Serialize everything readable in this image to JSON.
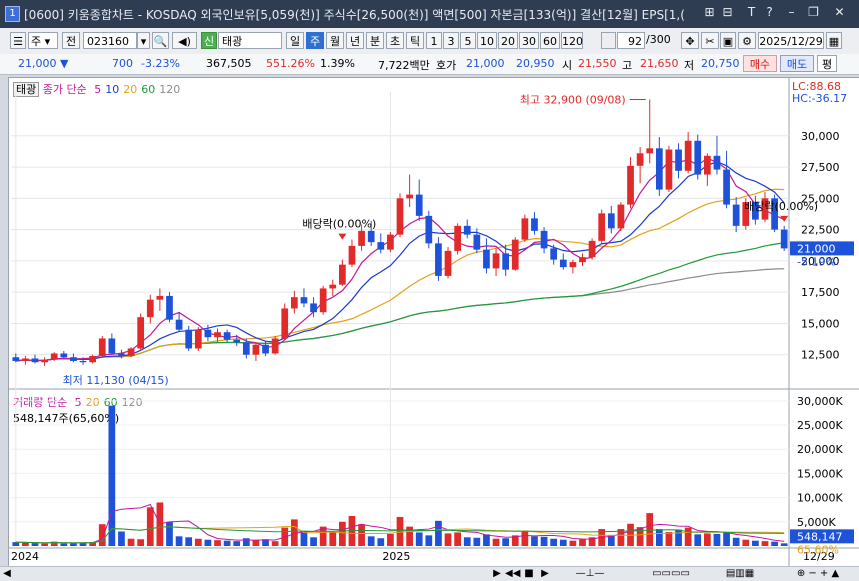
{
  "window": {
    "badge": "1",
    "title": "[0600] 키움종합차트 - KOSDAQ 외국인보유[5,059(천)] 주식수[26,500(천)] 액면[500] 자본금[133(억)] 결산[12월] EPS[1,(",
    "buttons": [
      "⊞",
      "⊟",
      "T",
      "?",
      "–",
      "❐",
      "✕"
    ]
  },
  "toolbar": {
    "type": "주",
    "period_sel": "전",
    "code": "023160",
    "name_badge": "신",
    "name": "태광",
    "periods": [
      "일",
      "주",
      "월",
      "년",
      "분",
      "초",
      "틱"
    ],
    "selected_period": "주",
    "intervals": [
      "1",
      "3",
      "5",
      "10",
      "20",
      "30",
      "60",
      "120"
    ],
    "count": "92",
    "count_total": "/300",
    "date": "2025/12/29"
  },
  "quote": {
    "price": "21,000",
    "change_arrow": "▼",
    "change": "700",
    "change_pct": "-3.23%",
    "volume": "367,505",
    "volume_ratio": "551.26%",
    "turnover": "1.39%",
    "amount": "7,722백만",
    "hoga_label": "호가",
    "ask": "21,000",
    "bid": "20,950",
    "open_label": "시",
    "open": "21,550",
    "high_label": "고",
    "high": "21,650",
    "low_label": "저",
    "low": "20,750",
    "buy": "매수",
    "sell": "매도",
    "avg": "평"
  },
  "legend_price": {
    "name": "태광",
    "ma_label": "종가 단순",
    "ma": [
      {
        "label": "5",
        "color": "#c2189b"
      },
      {
        "label": "10",
        "color": "#1a3bd0"
      },
      {
        "label": "20",
        "color": "#e3a21a"
      },
      {
        "label": "60",
        "color": "#1f9a3c"
      },
      {
        "label": "120",
        "color": "#8c8c8c"
      }
    ]
  },
  "legend_volume": {
    "label": "거래량 단순",
    "ma": [
      {
        "label": "5",
        "color": "#c2189b"
      },
      {
        "label": "20",
        "color": "#e3a21a"
      },
      {
        "label": "60",
        "color": "#1f9a3c"
      },
      {
        "label": "120",
        "color": "#8c8c8c"
      }
    ],
    "current": "548,147주(65,60%)"
  },
  "annotations": {
    "max": "최고 32,900 (09/08)",
    "min": "최저 11,130 (04/15)",
    "exdiv": "배당락(0.00%)",
    "lc": "LC:88.68",
    "hc": "HC:-36.17",
    "last_price": "21,000",
    "last_pct": "-5.19%",
    "vol_last": "548,147",
    "vol_pct": "65.60%",
    "date_end": "12/29"
  },
  "chart_data": [
    {
      "type": "candlestick",
      "yticks": [
        "12,500",
        "15,000",
        "17,500",
        "20,000",
        "22,500",
        "25,000",
        "27,500",
        "30,000"
      ],
      "ylim": [
        10000,
        33500
      ],
      "xticks": [
        "2024",
        "2025"
      ],
      "series": [
        {
          "name": "태광",
          "values": [
            [
              12300,
              12600,
              11900,
              12000
            ],
            [
              12000,
              12400,
              11700,
              12200
            ],
            [
              12200,
              12500,
              11800,
              11900
            ],
            [
              11900,
              12300,
              11600,
              12100
            ],
            [
              12100,
              12700,
              12000,
              12600
            ],
            [
              12600,
              12800,
              12200,
              12300
            ],
            [
              12300,
              12600,
              11900,
              12000
            ],
            [
              12000,
              12300,
              11700,
              11900
            ],
            [
              11900,
              12500,
              11800,
              12400
            ],
            [
              12400,
              14000,
              12300,
              13800
            ],
            [
              13800,
              14200,
              12500,
              12600
            ],
            [
              12600,
              12900,
              12200,
              12400
            ],
            [
              12400,
              13100,
              12300,
              13000
            ],
            [
              13000,
              15800,
              12900,
              15500
            ],
            [
              15500,
              17300,
              15000,
              16900
            ],
            [
              16900,
              17800,
              16000,
              17200
            ],
            [
              17200,
              17500,
              15100,
              15300
            ],
            [
              15300,
              15900,
              14400,
              14500
            ],
            [
              14500,
              14800,
              12800,
              13000
            ],
            [
              13000,
              14700,
              12800,
              14500
            ],
            [
              14500,
              14900,
              13600,
              13900
            ],
            [
              13900,
              14600,
              13500,
              14300
            ],
            [
              14300,
              14500,
              13500,
              13700
            ],
            [
              13700,
              14100,
              13200,
              13500
            ],
            [
              13500,
              13800,
              12200,
              12500
            ],
            [
              12500,
              13500,
              12000,
              13300
            ],
            [
              13300,
              13600,
              12400,
              12600
            ],
            [
              12600,
              14000,
              12500,
              13800
            ],
            [
              13800,
              16600,
              13700,
              16200
            ],
            [
              16200,
              17600,
              15800,
              17100
            ],
            [
              17100,
              17800,
              16300,
              16600
            ],
            [
              16600,
              17100,
              15500,
              15900
            ],
            [
              15900,
              18000,
              15700,
              17800
            ],
            [
              17800,
              18500,
              17200,
              18100
            ],
            [
              18100,
              20100,
              18000,
              19700
            ],
            [
              19700,
              21700,
              19500,
              21200
            ],
            [
              21200,
              22900,
              20800,
              22400
            ],
            [
              22400,
              23200,
              21200,
              21500
            ],
            [
              21500,
              22200,
              20600,
              20900
            ],
            [
              20900,
              22300,
              20700,
              22100
            ],
            [
              22100,
              25400,
              21900,
              25000
            ],
            [
              25000,
              26900,
              24300,
              25300
            ],
            [
              25300,
              26500,
              23200,
              23600
            ],
            [
              23600,
              24000,
              21000,
              21400
            ],
            [
              21400,
              21900,
              18400,
              18800
            ],
            [
              18800,
              21100,
              18600,
              20800
            ],
            [
              20800,
              23000,
              20500,
              22800
            ],
            [
              22800,
              23300,
              21800,
              22100
            ],
            [
              22100,
              22600,
              20600,
              20900
            ],
            [
              20900,
              21800,
              19000,
              19400
            ],
            [
              19400,
              21000,
              18800,
              20600
            ],
            [
              20600,
              21300,
              18800,
              19300
            ],
            [
              19300,
              21900,
              19200,
              21700
            ],
            [
              21700,
              23700,
              21500,
              23400
            ],
            [
              23400,
              23900,
              22100,
              22400
            ],
            [
              22400,
              22700,
              20600,
              21000
            ],
            [
              21000,
              21300,
              19700,
              20100
            ],
            [
              20100,
              20600,
              19300,
              19500
            ],
            [
              19500,
              20100,
              19000,
              19900
            ],
            [
              19900,
              20600,
              19600,
              20300
            ],
            [
              20300,
              21800,
              20100,
              21600
            ],
            [
              21600,
              24100,
              21400,
              23800
            ],
            [
              23800,
              24400,
              22200,
              22600
            ],
            [
              22600,
              24700,
              22400,
              24500
            ],
            [
              24500,
              28300,
              24200,
              27600
            ],
            [
              27600,
              29100,
              26200,
              28600
            ],
            [
              28600,
              32900,
              27800,
              29000
            ],
            [
              29000,
              29900,
              25200,
              25700
            ],
            [
              25700,
              29200,
              25500,
              28900
            ],
            [
              28900,
              29400,
              26600,
              27200
            ],
            [
              27200,
              30300,
              27000,
              29600
            ],
            [
              29600,
              30100,
              26500,
              26900
            ],
            [
              26900,
              28600,
              26000,
              28400
            ],
            [
              28400,
              30000,
              26900,
              27300
            ],
            [
              27300,
              28800,
              24200,
              24500
            ],
            [
              24500,
              25100,
              22300,
              22800
            ],
            [
              22800,
              25000,
              22500,
              24700
            ],
            [
              24700,
              25200,
              22900,
              23300
            ],
            [
              23300,
              25500,
              23100,
              25000
            ],
            [
              25000,
              25300,
              22300,
              22500
            ],
            [
              22500,
              22800,
              20800,
              21000
            ]
          ]
        }
      ]
    },
    {
      "type": "bar",
      "ylabel": "거래량",
      "yticks": [
        "5,000K",
        "10,000K",
        "15,000K",
        "20,000K",
        "25,000K",
        "30,000K"
      ],
      "ylim": [
        0,
        31000000
      ],
      "values": [
        800,
        700,
        600,
        500,
        900,
        500,
        600,
        700,
        800,
        4500,
        29000,
        3000,
        1500,
        1400,
        8000,
        9000,
        5000,
        2000,
        1800,
        1500,
        1300,
        1200,
        1100,
        1000,
        1600,
        1200,
        1400,
        1000,
        3800,
        5500,
        3000,
        1800,
        4000,
        2800,
        5000,
        6200,
        4500,
        2000,
        1600,
        2500,
        6000,
        4000,
        2800,
        2200,
        5200,
        2600,
        2800,
        1800,
        1700,
        2400,
        1500,
        1600,
        2200,
        3200,
        2000,
        1900,
        1500,
        1300,
        1100,
        1400,
        1800,
        3500,
        2200,
        3500,
        4600,
        3900,
        6800,
        3500,
        2900,
        3400,
        3800,
        2400,
        2600,
        2500,
        2800,
        1700,
        1300,
        1100,
        1000,
        900,
        548
      ]
    }
  ]
}
